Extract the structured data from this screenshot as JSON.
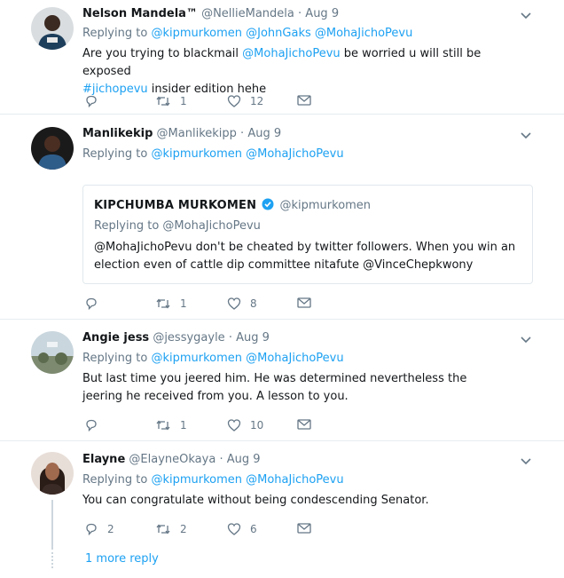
{
  "tweets": [
    {
      "name": "Nelson Mandela™",
      "handle": "@NellieMandela",
      "time": "Aug 9",
      "replying_label": "Replying to",
      "replying_to": [
        "@kipmurkomen",
        "@JohnGaks",
        "@MohaJichoPevu"
      ],
      "text_1": "Are you trying to blackmail ",
      "text_mention": "@MohaJichoPevu",
      "text_2": " be worried u will still be exposed",
      "text_hashtag": "#jichopevu",
      "text_3": " insider edition hehe",
      "replies": "",
      "retweets": "1",
      "likes": "12"
    },
    {
      "name": "Manlikekip",
      "handle": "@Manlikekipp",
      "time": "Aug 9",
      "replying_label": "Replying to",
      "replying_to": [
        "@kipmurkomen",
        "@MohaJichoPevu"
      ],
      "quote": {
        "name": "KIPCHUMBA MURKOMEN",
        "handle": "@kipmurkomen",
        "replying": "Replying to @MohaJichoPevu",
        "text": "@MohaJichoPevu don't be cheated by twitter followers. When you win an election even of cattle dip committee nitafute @VinceChepkwony"
      },
      "replies": "",
      "retweets": "1",
      "likes": "8"
    },
    {
      "name": "Angie jess",
      "handle": "@jessygayle",
      "time": "Aug 9",
      "replying_label": "Replying to",
      "replying_to": [
        "@kipmurkomen",
        "@MohaJichoPevu"
      ],
      "text": "But last time you jeered him. He was determined nevertheless the jeering he received from you. A lesson to you.",
      "replies": "",
      "retweets": "1",
      "likes": "10"
    },
    {
      "name": "Elayne",
      "handle": "@ElayneOkaya",
      "time": "Aug 9",
      "replying_label": "Replying to",
      "replying_to": [
        "@kipmurkomen",
        "@MohaJichoPevu"
      ],
      "text": "You can congratulate without being condescending Senator.",
      "replies": "2",
      "retweets": "2",
      "likes": "6"
    }
  ],
  "more_replies": "1 more reply",
  "colors": {
    "link": "#1da1f2",
    "muted": "#657786",
    "border": "#e6ecf0",
    "verified": "#1da1f2"
  },
  "icons": [
    "reply-icon",
    "retweet-icon",
    "like-icon",
    "dm-icon",
    "chevron-down-icon",
    "verified-icon"
  ]
}
